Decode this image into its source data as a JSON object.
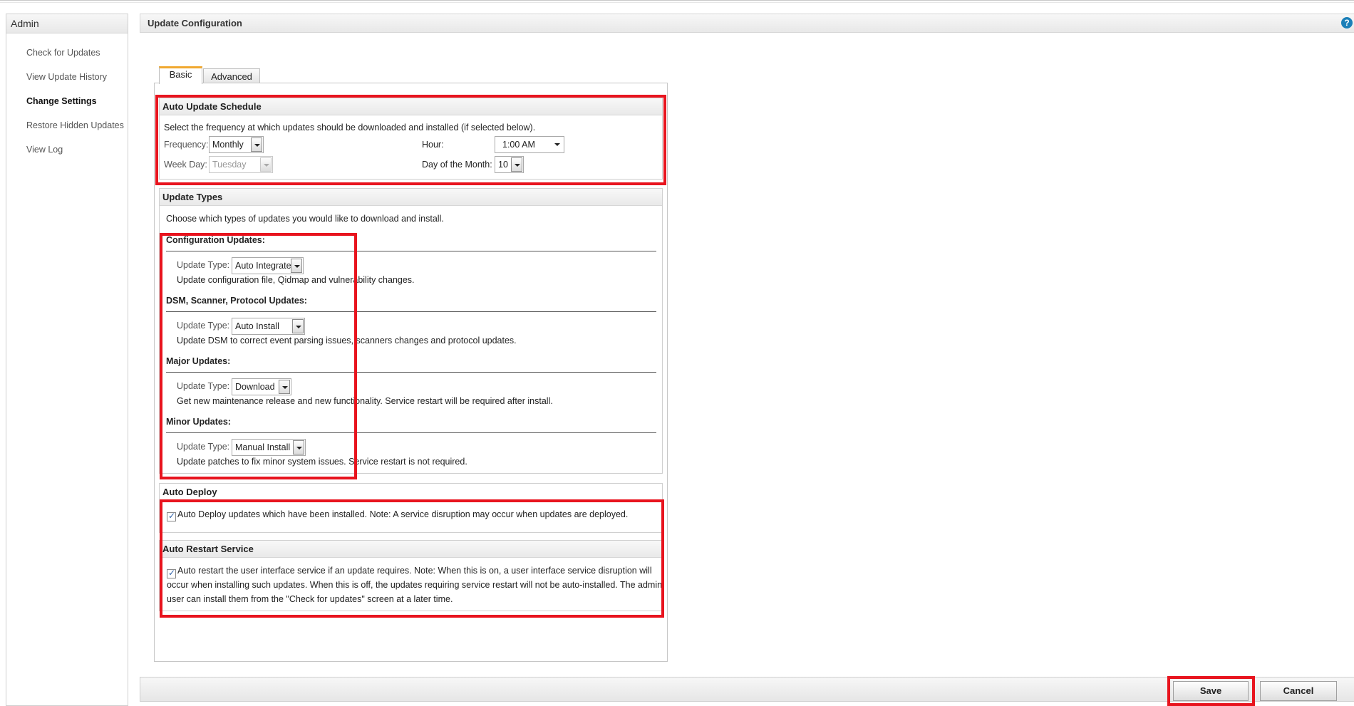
{
  "sidebar": {
    "title": "Admin",
    "items": [
      {
        "label": "Check for Updates"
      },
      {
        "label": "View Update History"
      },
      {
        "label": "Change Settings"
      },
      {
        "label": "Restore Hidden Updates"
      },
      {
        "label": "View Log"
      }
    ],
    "active_index": 2
  },
  "header": {
    "title": "Update Configuration",
    "help_icon": "?"
  },
  "tabs": [
    {
      "label": "Basic"
    },
    {
      "label": "Advanced"
    }
  ],
  "schedule": {
    "title": "Auto Update Schedule",
    "description": "Select the frequency at which updates should be downloaded and installed (if selected below).",
    "frequency_label": "Frequency:",
    "frequency_value": "Monthly",
    "weekday_label": "Week Day:",
    "weekday_value": "Tuesday",
    "hour_label": "Hour:",
    "hour_value": "1:00 AM",
    "dom_label": "Day of the Month:",
    "dom_value": "10"
  },
  "update_types": {
    "title": "Update Types",
    "description": "Choose which types of updates you would like to download and install.",
    "type_label": "Update Type:",
    "groups": [
      {
        "heading": "Configuration Updates:",
        "value": "Auto Integrate",
        "description": "Update configuration file, Qidmap and vulnerability changes."
      },
      {
        "heading": "DSM, Scanner, Protocol Updates:",
        "value": "Auto Install",
        "description": "Update DSM to correct event parsing issues, scanners changes and protocol updates."
      },
      {
        "heading": "Major Updates:",
        "value": "Download",
        "description": "Get new maintenance release and new functionality. Service restart will be required after install."
      },
      {
        "heading": "Minor Updates:",
        "value": "Manual Install",
        "description": "Update patches to fix minor system issues. Service restart is not required."
      }
    ]
  },
  "auto_deploy": {
    "title": "Auto Deploy",
    "checked": true,
    "text": "Auto Deploy updates which have been installed. Note: A service disruption may occur when updates are deployed."
  },
  "auto_restart": {
    "title": "Auto Restart Service",
    "checked": true,
    "line1": "Auto restart the user interface service if an update requires. Note: When this is on, a user interface service disruption will",
    "line2": "occur when installing such updates. When this is off, the updates requiring service restart will not be auto-installed. The admin",
    "line3": "user can install them from the \"Check for updates\" screen at a later time."
  },
  "footer": {
    "save_label": "Save",
    "cancel_label": "Cancel"
  },
  "colors": {
    "highlight": "#e8141e",
    "tab_accent": "#f0a830",
    "help_icon": "#1b7fb8"
  }
}
